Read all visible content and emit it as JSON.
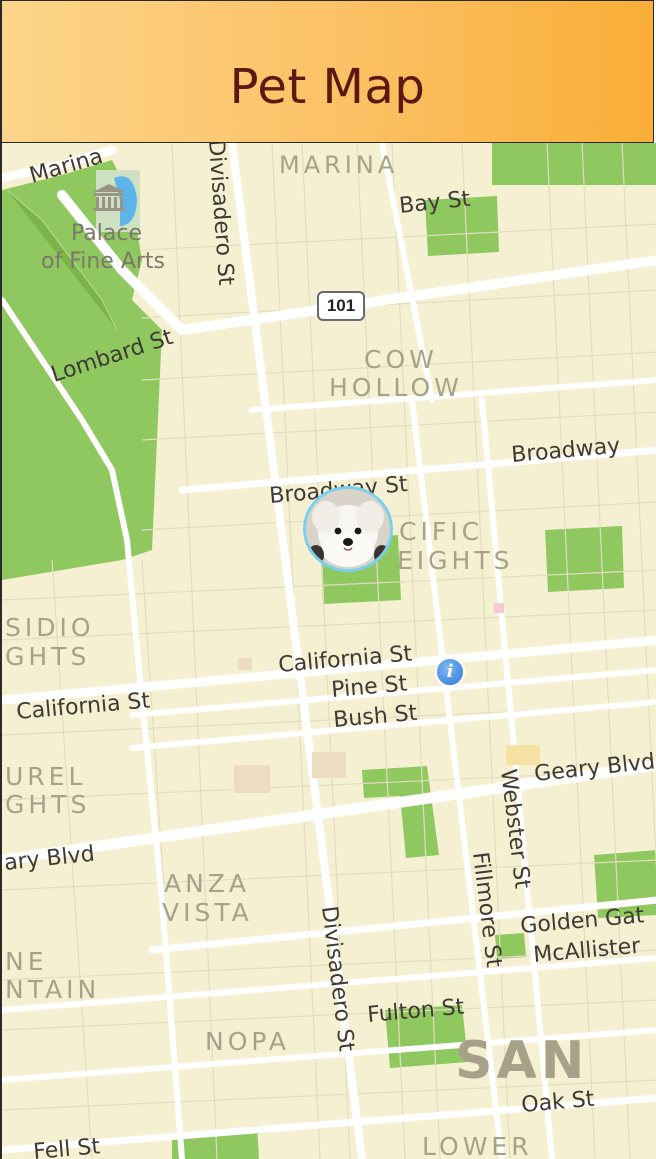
{
  "header": {
    "title": "Pet Map"
  },
  "colors": {
    "header_start": "#fcd58a",
    "header_end": "#f9ae37",
    "title": "#5a1a12",
    "map_background": "#f6f0d3",
    "park": "#90c860",
    "marker_ring": "#7ad0ec",
    "info_button": "#2d76d8"
  },
  "map": {
    "landmark": {
      "line1": "Palace",
      "line2": "of Fine Arts",
      "icon": "museum-icon"
    },
    "highway_shield": "101",
    "info_icon": "i",
    "pet_marker": {
      "icon": "dog-photo-icon"
    },
    "districts": {
      "marina": "MARINA",
      "cow": "COW",
      "hollow": "HOLLOW",
      "pacific": "CIFIC",
      "heights": "EIGHTS",
      "presidio": "SIDIO",
      "presidio_heights": "GHTS",
      "laurel": "UREL",
      "laurel_heights": "GHTS",
      "anza": "ANZA",
      "vista": "VISTA",
      "lone": "NE",
      "mountain": "NTAIN",
      "nopa": "NOPA",
      "san": "SAN",
      "lower": "LOWER"
    },
    "streets": {
      "marina_blvd": "Marina",
      "bay": "Bay St",
      "divisadero_top": "Divisadero St",
      "lombard": "Lombard St",
      "broadway_st": "Broadway St",
      "broadway": "Broadway",
      "california_right": "California St",
      "california_left": "California St",
      "pine": "Pine St",
      "bush": "Bush St",
      "geary_right": "Geary Blvd",
      "geary_left": "ary Blvd",
      "webster": "Webster St",
      "fillmore": "Fillmore St",
      "divisadero_bottom": "Divisadero St",
      "golden_gate": "Golden Gat",
      "mcallister": "McAllister",
      "fulton": "Fulton St",
      "oak": "Oak St",
      "fell": "Fell St"
    }
  }
}
